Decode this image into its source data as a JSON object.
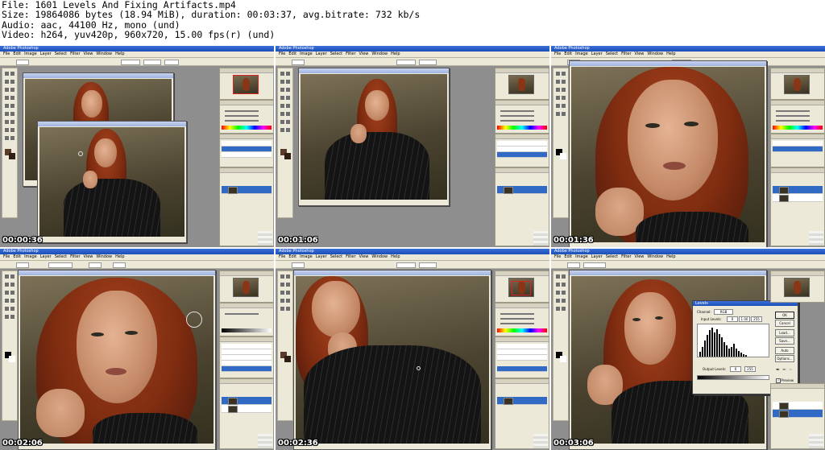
{
  "video_info": {
    "file": "File: 1601 Levels And Fixing Artifacts.mp4",
    "size": "Size: 19864086 bytes (18.94 MiB), duration: 00:03:37, avg.bitrate: 732 kb/s",
    "audio": "Audio: aac, 44100 Hz, mono (und)",
    "video": "Video: h264, yuv420p, 960x720, 15.00 fps(r) (und)"
  },
  "frames": [
    {
      "timestamp": "00:00:36"
    },
    {
      "timestamp": "00:01:06"
    },
    {
      "timestamp": "00:01:36"
    },
    {
      "timestamp": "00:02:06"
    },
    {
      "timestamp": "00:02:36"
    },
    {
      "timestamp": "00:03:06"
    }
  ],
  "app": {
    "title": "Adobe Photoshop",
    "menu": [
      "File",
      "Edit",
      "Image",
      "Layer",
      "Select",
      "Filter",
      "View",
      "Window",
      "Help"
    ]
  },
  "levels_dialog": {
    "title": "Levels",
    "channel_label": "Channel:",
    "channel_value": "RGB",
    "input_levels_label": "Input Levels:",
    "input_values": [
      "0",
      "1.00",
      "255"
    ],
    "output_levels_label": "Output Levels:",
    "output_values": [
      "0",
      "255"
    ],
    "buttons": [
      "OK",
      "Cancel",
      "Load...",
      "Save...",
      "Auto",
      "Options..."
    ],
    "preview_label": "Preview"
  },
  "colors": {
    "titlebar": "#1c4fb8",
    "panel_bg": "#ece9d8",
    "selection": "#316ac5",
    "canvas_bg": "#8e8e8e"
  }
}
